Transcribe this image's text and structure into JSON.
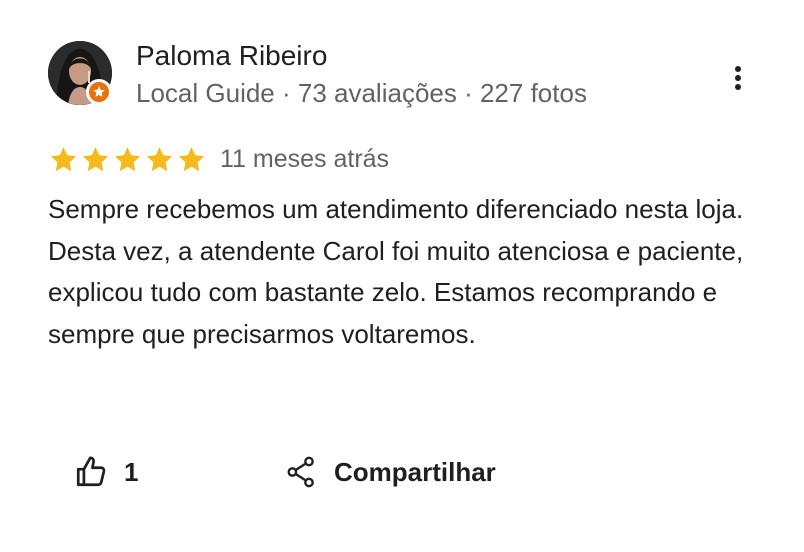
{
  "reviewer": {
    "name": "Paloma Ribeiro",
    "meta": "Local Guide · 73 avaliações · 227 fotos",
    "avatar_icon": "profile-photo",
    "badge_icon": "local-guide-star-icon",
    "badge_color": "#e8710a"
  },
  "review": {
    "rating": 5,
    "rating_max": 5,
    "star_color": "#f6b91a",
    "date": "11 meses atrás",
    "text": "Sempre recebemos um atendimento diferenciado nesta loja. Desta vez, a atendente Carol foi muito atenciosa e paciente, explicou tudo com bastante zelo. Estamos recomprando e sempre que precisarmos voltaremos."
  },
  "actions": {
    "like_count": "1",
    "share_label": "Compartilhar"
  }
}
